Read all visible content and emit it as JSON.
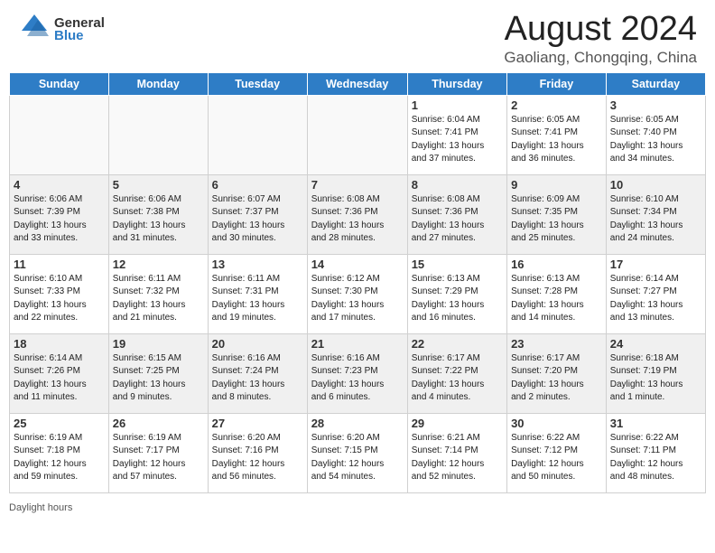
{
  "header": {
    "logo_general": "General",
    "logo_blue": "Blue",
    "title": "August 2024",
    "subtitle": "Gaoliang, Chongqing, China"
  },
  "days_of_week": [
    "Sunday",
    "Monday",
    "Tuesday",
    "Wednesday",
    "Thursday",
    "Friday",
    "Saturday"
  ],
  "weeks": [
    [
      {
        "date": "",
        "info": "",
        "empty": true
      },
      {
        "date": "",
        "info": "",
        "empty": true
      },
      {
        "date": "",
        "info": "",
        "empty": true
      },
      {
        "date": "",
        "info": "",
        "empty": true
      },
      {
        "date": "1",
        "info": "Sunrise: 6:04 AM\nSunset: 7:41 PM\nDaylight: 13 hours\nand 37 minutes.",
        "empty": false
      },
      {
        "date": "2",
        "info": "Sunrise: 6:05 AM\nSunset: 7:41 PM\nDaylight: 13 hours\nand 36 minutes.",
        "empty": false
      },
      {
        "date": "3",
        "info": "Sunrise: 6:05 AM\nSunset: 7:40 PM\nDaylight: 13 hours\nand 34 minutes.",
        "empty": false
      }
    ],
    [
      {
        "date": "4",
        "info": "Sunrise: 6:06 AM\nSunset: 7:39 PM\nDaylight: 13 hours\nand 33 minutes.",
        "empty": false
      },
      {
        "date": "5",
        "info": "Sunrise: 6:06 AM\nSunset: 7:38 PM\nDaylight: 13 hours\nand 31 minutes.",
        "empty": false
      },
      {
        "date": "6",
        "info": "Sunrise: 6:07 AM\nSunset: 7:37 PM\nDaylight: 13 hours\nand 30 minutes.",
        "empty": false
      },
      {
        "date": "7",
        "info": "Sunrise: 6:08 AM\nSunset: 7:36 PM\nDaylight: 13 hours\nand 28 minutes.",
        "empty": false
      },
      {
        "date": "8",
        "info": "Sunrise: 6:08 AM\nSunset: 7:36 PM\nDaylight: 13 hours\nand 27 minutes.",
        "empty": false
      },
      {
        "date": "9",
        "info": "Sunrise: 6:09 AM\nSunset: 7:35 PM\nDaylight: 13 hours\nand 25 minutes.",
        "empty": false
      },
      {
        "date": "10",
        "info": "Sunrise: 6:10 AM\nSunset: 7:34 PM\nDaylight: 13 hours\nand 24 minutes.",
        "empty": false
      }
    ],
    [
      {
        "date": "11",
        "info": "Sunrise: 6:10 AM\nSunset: 7:33 PM\nDaylight: 13 hours\nand 22 minutes.",
        "empty": false
      },
      {
        "date": "12",
        "info": "Sunrise: 6:11 AM\nSunset: 7:32 PM\nDaylight: 13 hours\nand 21 minutes.",
        "empty": false
      },
      {
        "date": "13",
        "info": "Sunrise: 6:11 AM\nSunset: 7:31 PM\nDaylight: 13 hours\nand 19 minutes.",
        "empty": false
      },
      {
        "date": "14",
        "info": "Sunrise: 6:12 AM\nSunset: 7:30 PM\nDaylight: 13 hours\nand 17 minutes.",
        "empty": false
      },
      {
        "date": "15",
        "info": "Sunrise: 6:13 AM\nSunset: 7:29 PM\nDaylight: 13 hours\nand 16 minutes.",
        "empty": false
      },
      {
        "date": "16",
        "info": "Sunrise: 6:13 AM\nSunset: 7:28 PM\nDaylight: 13 hours\nand 14 minutes.",
        "empty": false
      },
      {
        "date": "17",
        "info": "Sunrise: 6:14 AM\nSunset: 7:27 PM\nDaylight: 13 hours\nand 13 minutes.",
        "empty": false
      }
    ],
    [
      {
        "date": "18",
        "info": "Sunrise: 6:14 AM\nSunset: 7:26 PM\nDaylight: 13 hours\nand 11 minutes.",
        "empty": false
      },
      {
        "date": "19",
        "info": "Sunrise: 6:15 AM\nSunset: 7:25 PM\nDaylight: 13 hours\nand 9 minutes.",
        "empty": false
      },
      {
        "date": "20",
        "info": "Sunrise: 6:16 AM\nSunset: 7:24 PM\nDaylight: 13 hours\nand 8 minutes.",
        "empty": false
      },
      {
        "date": "21",
        "info": "Sunrise: 6:16 AM\nSunset: 7:23 PM\nDaylight: 13 hours\nand 6 minutes.",
        "empty": false
      },
      {
        "date": "22",
        "info": "Sunrise: 6:17 AM\nSunset: 7:22 PM\nDaylight: 13 hours\nand 4 minutes.",
        "empty": false
      },
      {
        "date": "23",
        "info": "Sunrise: 6:17 AM\nSunset: 7:20 PM\nDaylight: 13 hours\nand 2 minutes.",
        "empty": false
      },
      {
        "date": "24",
        "info": "Sunrise: 6:18 AM\nSunset: 7:19 PM\nDaylight: 13 hours\nand 1 minute.",
        "empty": false
      }
    ],
    [
      {
        "date": "25",
        "info": "Sunrise: 6:19 AM\nSunset: 7:18 PM\nDaylight: 12 hours\nand 59 minutes.",
        "empty": false
      },
      {
        "date": "26",
        "info": "Sunrise: 6:19 AM\nSunset: 7:17 PM\nDaylight: 12 hours\nand 57 minutes.",
        "empty": false
      },
      {
        "date": "27",
        "info": "Sunrise: 6:20 AM\nSunset: 7:16 PM\nDaylight: 12 hours\nand 56 minutes.",
        "empty": false
      },
      {
        "date": "28",
        "info": "Sunrise: 6:20 AM\nSunset: 7:15 PM\nDaylight: 12 hours\nand 54 minutes.",
        "empty": false
      },
      {
        "date": "29",
        "info": "Sunrise: 6:21 AM\nSunset: 7:14 PM\nDaylight: 12 hours\nand 52 minutes.",
        "empty": false
      },
      {
        "date": "30",
        "info": "Sunrise: 6:22 AM\nSunset: 7:12 PM\nDaylight: 12 hours\nand 50 minutes.",
        "empty": false
      },
      {
        "date": "31",
        "info": "Sunrise: 6:22 AM\nSunset: 7:11 PM\nDaylight: 12 hours\nand 48 minutes.",
        "empty": false
      }
    ]
  ],
  "footer": {
    "daylight_label": "Daylight hours"
  }
}
